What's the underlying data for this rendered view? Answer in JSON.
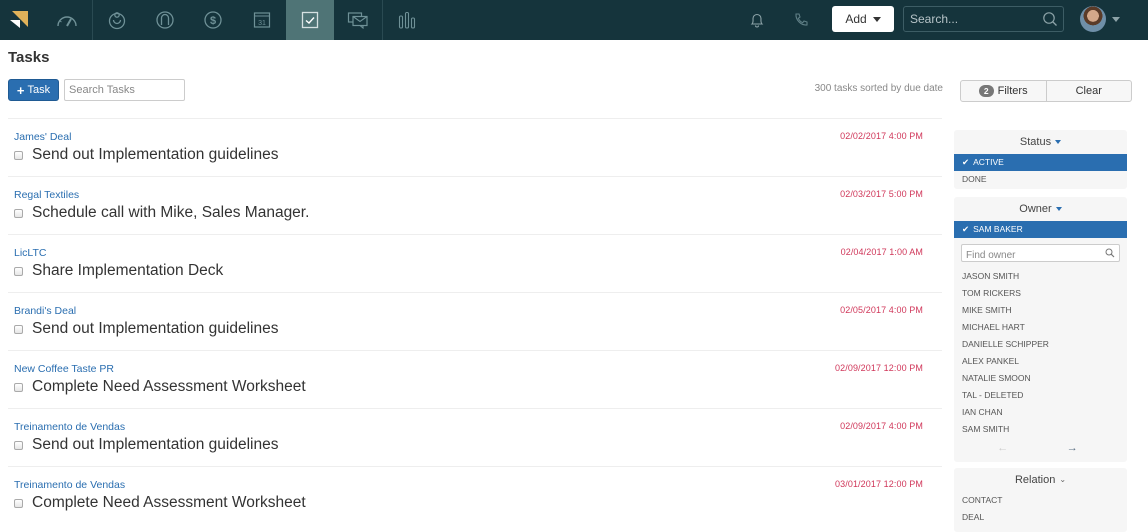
{
  "nav": {
    "items": [
      {
        "name": "dashboard",
        "icon": "gauge-icon"
      },
      {
        "name": "leads",
        "icon": "target-person-icon"
      },
      {
        "name": "contacts",
        "icon": "person-circle-icon"
      },
      {
        "name": "deals",
        "icon": "dollar-icon"
      },
      {
        "name": "calendar",
        "icon": "calendar-icon",
        "day": "31"
      },
      {
        "name": "tasks",
        "icon": "checkbox-icon",
        "active": true
      },
      {
        "name": "communications",
        "icon": "mail-chat-icon"
      },
      {
        "name": "reports",
        "icon": "bar-chart-icon"
      }
    ],
    "add_label": "Add",
    "search_placeholder": "Search..."
  },
  "page": {
    "title": "Tasks",
    "new_task_label": "Task",
    "search_placeholder": "Search Tasks",
    "count_text": "300 tasks sorted by due date"
  },
  "tasks": [
    {
      "related": "James' Deal",
      "title": "Send out Implementation guidelines",
      "due": "02/02/2017 4:00 PM"
    },
    {
      "related": "Regal Textiles",
      "title": "Schedule call with Mike, Sales Manager.",
      "due": "02/03/2017 5:00 PM"
    },
    {
      "related": "LicLTC",
      "title": "Share Implementation Deck",
      "due": "02/04/2017 1:00 AM"
    },
    {
      "related": "Brandi's Deal",
      "title": "Send out Implementation guidelines",
      "due": "02/05/2017 4:00 PM"
    },
    {
      "related": "New Coffee Taste PR",
      "title": "Complete Need Assessment Worksheet",
      "due": "02/09/2017 12:00 PM"
    },
    {
      "related": "Treinamento de Vendas",
      "title": "Send out Implementation guidelines",
      "due": "02/09/2017 4:00 PM"
    },
    {
      "related": "Treinamento de Vendas",
      "title": "Complete Need Assessment Worksheet",
      "due": "03/01/2017 12:00 PM"
    }
  ],
  "filters": {
    "count_badge": "2",
    "filters_label": "Filters",
    "clear_label": "Clear",
    "status": {
      "title": "Status",
      "options": [
        {
          "label": "ACTIVE",
          "selected": true
        },
        {
          "label": "DONE",
          "selected": false
        }
      ]
    },
    "owner": {
      "title": "Owner",
      "selected": "SAM BAKER",
      "search_placeholder": "Find owner",
      "options": [
        "JASON SMITH",
        "TOM RICKERS",
        "MIKE SMITH",
        "MICHAEL HART",
        "DANIELLE SCHIPPER",
        "ALEX PANKEL",
        "NATALIE SMOON",
        "TAL - DELETED",
        "IAN CHAN",
        "SAM SMITH"
      ],
      "prev_icon": "←",
      "next_icon": "→"
    },
    "relation": {
      "title": "Relation",
      "chevron": "⌄",
      "options": [
        "CONTACT",
        "DEAL"
      ]
    }
  },
  "colors": {
    "nav_bg": "#15343c",
    "nav_active": "#4f7476",
    "accent": "#2a6eb0",
    "due_date": "#d0375a",
    "logo": "#e0b25a"
  }
}
